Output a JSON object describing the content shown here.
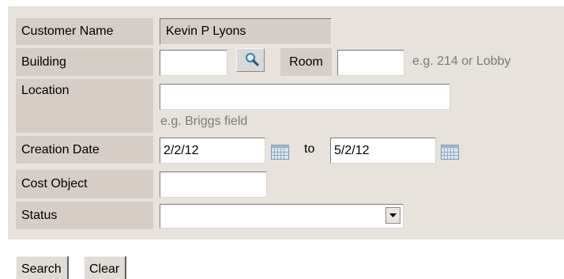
{
  "form": {
    "customer_name": {
      "label": "Customer Name",
      "value": "Kevin P Lyons"
    },
    "building": {
      "label": "Building",
      "value": "",
      "search_icon": "magnifier-icon"
    },
    "room": {
      "label": "Room",
      "value": "",
      "hint": "e.g. 214 or Lobby"
    },
    "location": {
      "label": "Location",
      "value": "",
      "hint": "e.g. Briggs field"
    },
    "creation_date": {
      "label": "Creation Date",
      "from": "2/2/12",
      "to_label": "to",
      "to": "5/2/12",
      "calendar_icon": "calendar-icon"
    },
    "cost_object": {
      "label": "Cost Object",
      "value": ""
    },
    "status": {
      "label": "Status",
      "value": "",
      "arrow_icon": "chevron-down-icon"
    }
  },
  "buttons": {
    "search": "Search",
    "clear": "Clear"
  },
  "colors": {
    "panel_bg": "#e7e2dc",
    "label_bg": "#d6cec6",
    "hint": "#7a7a7a"
  }
}
